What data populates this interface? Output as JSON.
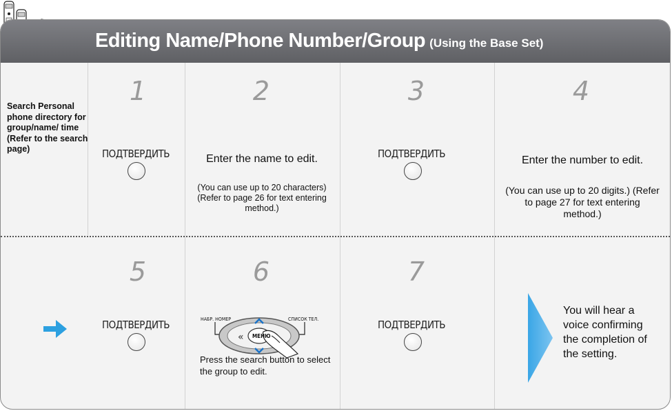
{
  "header": {
    "title": "Editing Name/Phone Number/Group",
    "subtitle": "(Using the Base Set)"
  },
  "left_panel": {
    "text": "Search Personal phone directory for group/name/ time (Refer to the search page)"
  },
  "steps": [
    {
      "number": "1",
      "button_label": "ПОДТВЕРДИТЬ"
    },
    {
      "number": "2",
      "main": "Enter the name to edit.",
      "note": "(You can use up to 20 characters) (Refer to page 26 for text entering method.)"
    },
    {
      "number": "3",
      "button_label": "ПОДТВЕРДИТЬ"
    },
    {
      "number": "4",
      "main": "Enter the number to edit.",
      "note": "(You can use up to 20 digits.) (Refer to page 27 for text entering method.)"
    },
    {
      "number": "5",
      "button_label": "ПОДТВЕРДИТЬ"
    },
    {
      "number": "6",
      "menu_left_label": "НАБР. НОМЕР",
      "menu_right_label": "СПИСОК ТЕЛ.",
      "menu_center": "МЕНЮ",
      "text": "Press the search button to select the group to edit."
    },
    {
      "number": "7",
      "button_label": "ПОДТВЕРДИТЬ"
    }
  ],
  "final_message": "You will hear a voice confirming the completion of the setting.",
  "colors": {
    "header_bg": "#6e6f73",
    "accent_blue": "#2ca0e0",
    "panel_bg": "#f3f3f3"
  }
}
